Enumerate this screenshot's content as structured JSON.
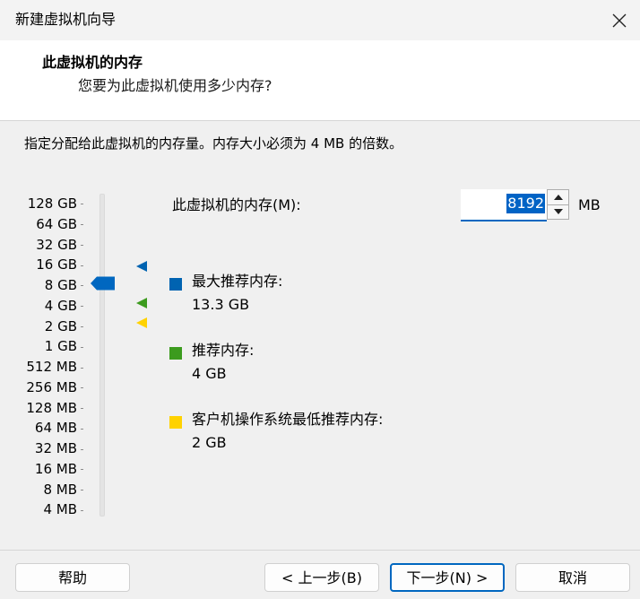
{
  "window": {
    "title": "新建虚拟机向导"
  },
  "header": {
    "title": "此虚拟机的内存",
    "subtitle": "您要为此虚拟机使用多少内存?"
  },
  "instruction": "指定分配给此虚拟机的内存量。内存大小必须为 4 MB 的倍数。",
  "memory": {
    "label": "此虚拟机的内存(M):",
    "value": "8192",
    "unit": "MB"
  },
  "scale": {
    "labels": [
      "128 GB",
      "64 GB",
      "32 GB",
      "16 GB",
      "8 GB",
      "4 GB",
      "2 GB",
      "1 GB",
      "512 MB",
      "256 MB",
      "128 MB",
      "64 MB",
      "32 MB",
      "16 MB",
      "8 MB",
      "4 MB"
    ],
    "selected": "8 GB"
  },
  "legend": {
    "max": {
      "label": "最大推荐内存:",
      "value": "13.3 GB",
      "color": "#0063b1"
    },
    "recommended": {
      "label": "推荐内存:",
      "value": "4 GB",
      "color": "#3c9b1e"
    },
    "minimum": {
      "label": "客户机操作系统最低推荐内存:",
      "value": "2 GB",
      "color": "#ffd200"
    }
  },
  "buttons": {
    "help": "帮助",
    "back": "< 上一步(B)",
    "next": "下一步(N) >",
    "cancel": "取消"
  },
  "icons": {
    "close": "close-icon",
    "spin_up": "arrow-up-icon",
    "spin_down": "arrow-down-icon"
  }
}
